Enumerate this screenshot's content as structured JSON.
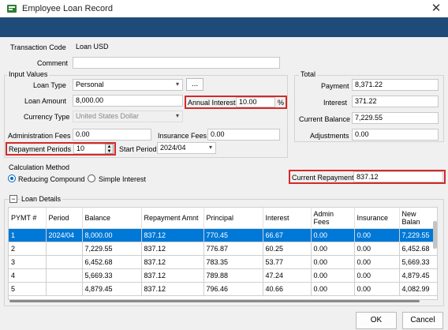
{
  "window": {
    "title": "Employee Loan Record",
    "close_glyph": "✕"
  },
  "header": {
    "transaction_code_label": "Transaction Code",
    "transaction_code_value": "Loan USD",
    "comment_label": "Comment",
    "comment_value": ""
  },
  "input_values": {
    "title": "Input Values",
    "loan_type_label": "Loan Type",
    "loan_type_value": "Personal",
    "browse_label": "...",
    "loan_amount_label": "Loan Amount",
    "loan_amount_value": "8,000.00",
    "annual_interest_label": "Annual Interest",
    "annual_interest_value": "10.00",
    "percent_sign": "%",
    "currency_type_label": "Currency Type",
    "currency_type_value": "United States Dollar",
    "admin_fees_label": "Administration Fees",
    "admin_fees_value": "0.00",
    "insurance_fees_label": "Insurance Fees",
    "insurance_fees_value": "0.00",
    "repayment_periods_label": "Repayment Periods",
    "repayment_periods_value": "10",
    "start_period_label": "Start Period",
    "start_period_value": "2024/04"
  },
  "total": {
    "title": "Total",
    "payment_label": "Payment",
    "payment_value": "8,371.22",
    "interest_label": "Interest",
    "interest_value": "371.22",
    "current_balance_label": "Current Balance",
    "current_balance_value": "7,229.55",
    "adjustments_label": "Adjustments",
    "adjustments_value": "0.00"
  },
  "calculation": {
    "title": "Calculation Method",
    "option_reducing": "Reducing Compound",
    "option_simple": "Simple Interest",
    "selected": "reducing",
    "current_repayment_label": "Current Repayment",
    "current_repayment_value": "837.12"
  },
  "loan_details": {
    "title": "Loan Details",
    "toggle_glyph": "−",
    "columns": [
      "PYMT #",
      "Period",
      "Balance",
      "Repayment Amnt",
      "Principal",
      "Interest",
      "Admin Fees",
      "Insurance",
      "New Balan"
    ],
    "rows": [
      [
        "1",
        "2024/04",
        "8,000.00",
        "837.12",
        "770.45",
        "66.67",
        "0.00",
        "0.00",
        "7,229.55"
      ],
      [
        "2",
        "",
        "7,229.55",
        "837.12",
        "776.87",
        "60.25",
        "0.00",
        "0.00",
        "6,452.68"
      ],
      [
        "3",
        "",
        "6,452.68",
        "837.12",
        "783.35",
        "53.77",
        "0.00",
        "0.00",
        "5,669.33"
      ],
      [
        "4",
        "",
        "5,669.33",
        "837.12",
        "789.88",
        "47.24",
        "0.00",
        "0.00",
        "4,879.45"
      ],
      [
        "5",
        "",
        "4,879.45",
        "837.12",
        "796.46",
        "40.66",
        "0.00",
        "0.00",
        "4,082.99"
      ]
    ]
  },
  "buttons": {
    "ok": "OK",
    "cancel": "Cancel"
  },
  "colors": {
    "header_band": "#1f4b78",
    "selection": "#0078d7",
    "highlight_border": "#d42a2a"
  }
}
